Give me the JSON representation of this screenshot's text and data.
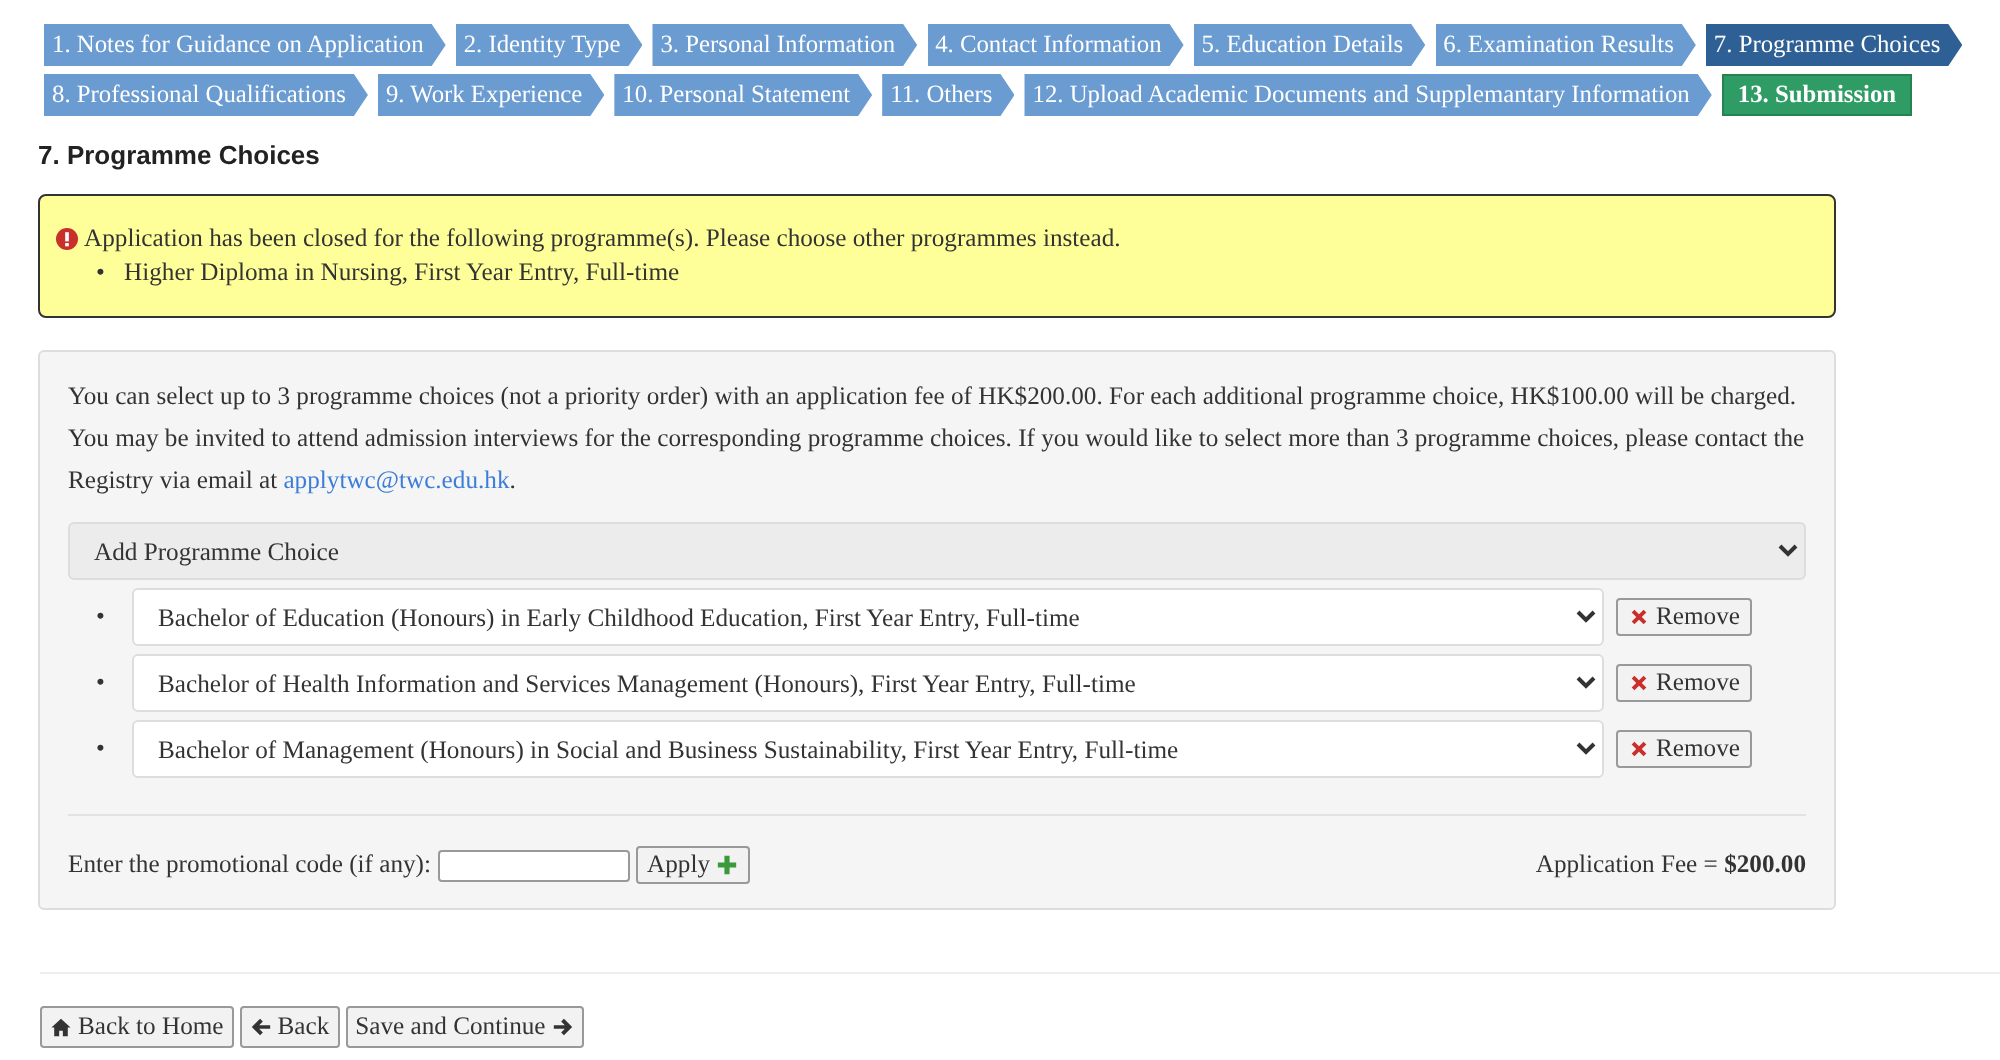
{
  "steps": [
    {
      "label": "1. Notes for Guidance on Application",
      "kind": "step",
      "selected": false
    },
    {
      "label": "2. Identity Type",
      "kind": "step",
      "selected": false
    },
    {
      "label": "3. Personal Information",
      "kind": "step",
      "selected": false
    },
    {
      "label": "4. Contact Information",
      "kind": "step",
      "selected": false
    },
    {
      "label": "5. Education Details",
      "kind": "step",
      "selected": false
    },
    {
      "label": "6. Examination Results",
      "kind": "step",
      "selected": false
    },
    {
      "label": "7. Programme Choices",
      "kind": "step",
      "selected": true
    },
    {
      "label": "8. Professional Qualifications",
      "kind": "step",
      "selected": false
    },
    {
      "label": "9. Work Experience",
      "kind": "step",
      "selected": false
    },
    {
      "label": "10. Personal Statement",
      "kind": "step",
      "selected": false
    },
    {
      "label": "11. Others",
      "kind": "step",
      "selected": false
    },
    {
      "label": "12. Upload Academic Documents and Supplemantary Information",
      "kind": "step",
      "selected": false
    },
    {
      "label": "13. Submission",
      "kind": "submit",
      "selected": false
    }
  ],
  "heading": "7. Programme Choices",
  "alert": {
    "message": "Application has been closed for the following programme(s). Please choose other programmes instead.",
    "marker": "•",
    "items": [
      "Higher Diploma in Nursing, First Year Entry, Full-time"
    ]
  },
  "intro": {
    "text": "You can select up to 3 programme choices (not a priority order) with an application fee of HK$200.00. For each additional programme choice, HK$100.00 will be charged. You may be invited to attend admission interviews for the corresponding programme choices. If you would like to select more than 3 programme choices, please contact the Registry via email at ",
    "link": "applytwc@twc.edu.hk",
    "tail": "."
  },
  "add_choice": "Add Programme Choice",
  "choices": [
    {
      "marker": "•",
      "programme": "Bachelor of Education (Honours) in Early Childhood Education, First Year Entry, Full-time",
      "remove": "Remove"
    },
    {
      "marker": "•",
      "programme": "Bachelor of Health Information and Services Management (Honours), First Year Entry, Full-time",
      "remove": "Remove"
    },
    {
      "marker": "•",
      "programme": "Bachelor of Management (Honours) in Social and Business Sustainability, First Year Entry, Full-time",
      "remove": "Remove"
    }
  ],
  "promo": {
    "label": "Enter the promotional code (if any):",
    "apply": "Apply"
  },
  "fee": {
    "label": "Application Fee = ",
    "amount": "$200.00"
  },
  "buttons": [
    {
      "label": "Back to Home",
      "kind": "home"
    },
    {
      "label": "Back",
      "kind": "back"
    },
    {
      "label": "Save and Continue",
      "kind": "next"
    }
  ]
}
